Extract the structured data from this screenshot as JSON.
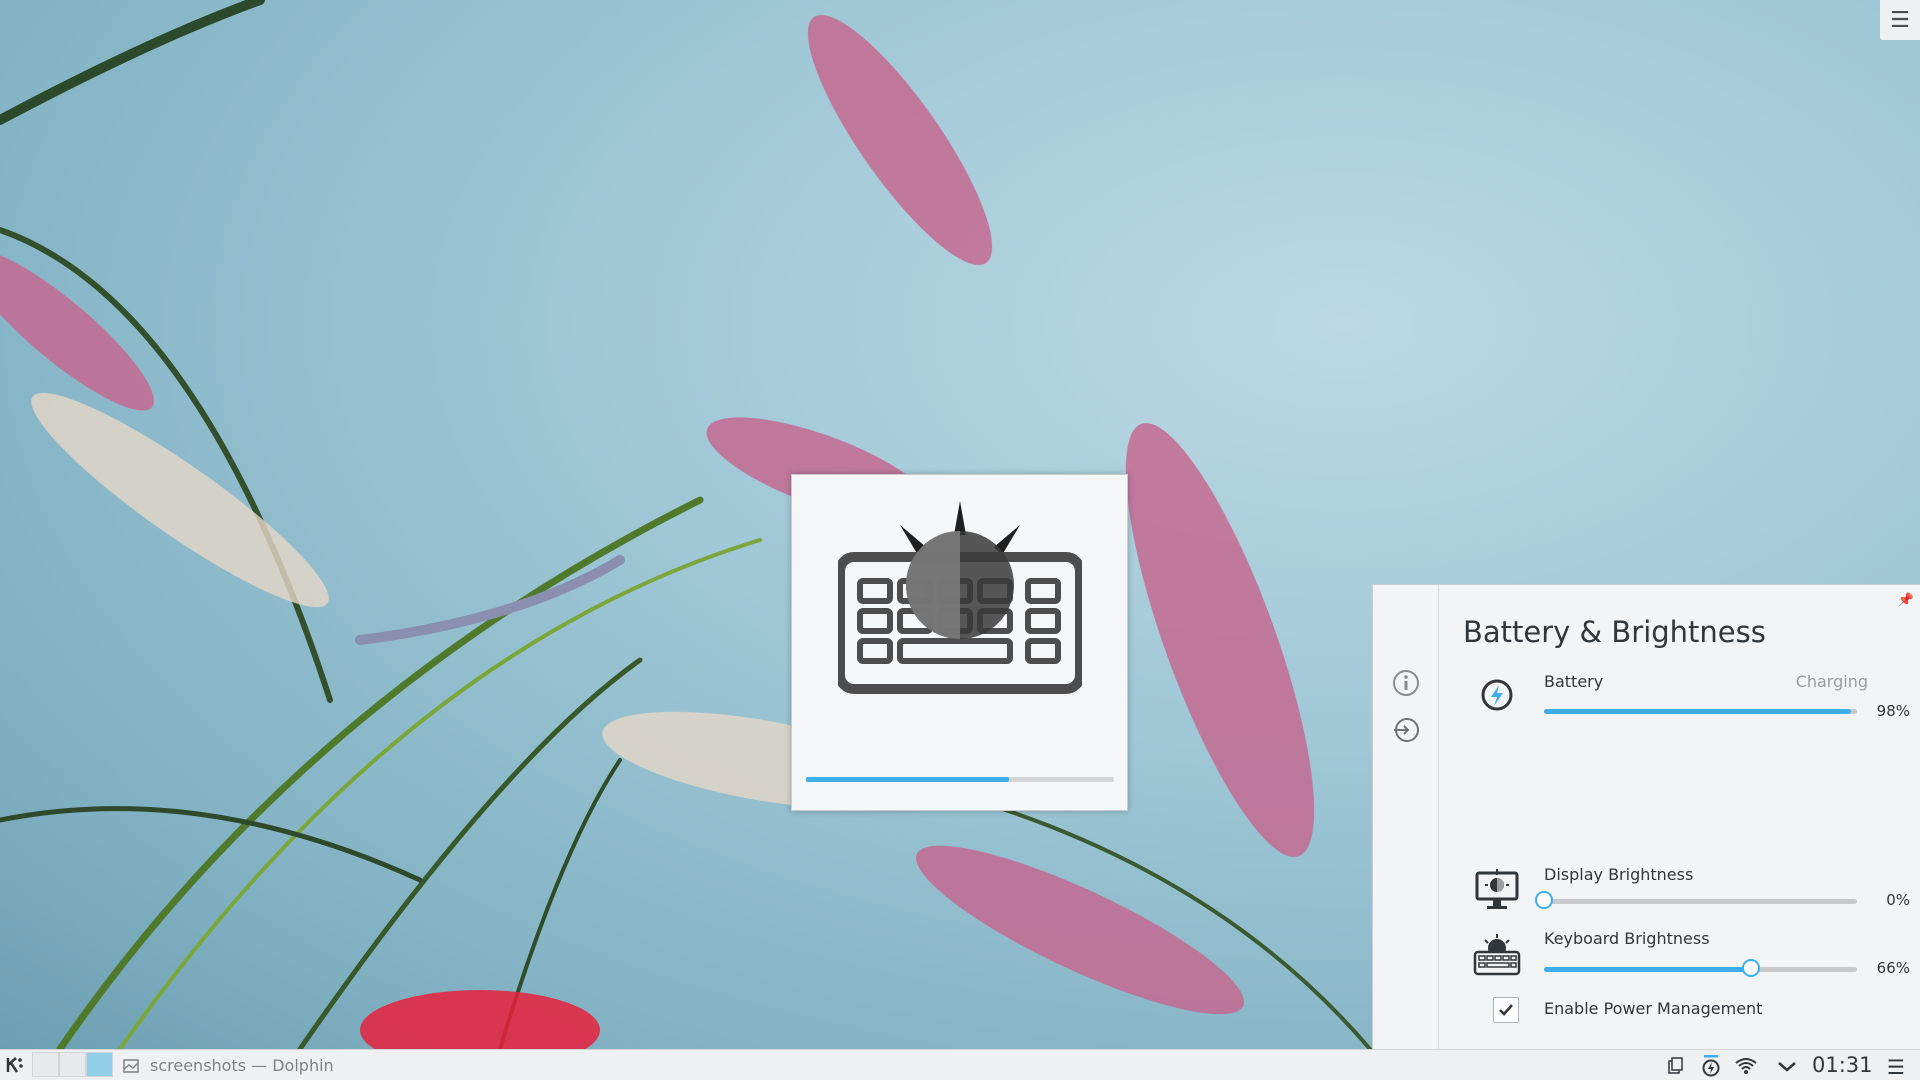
{
  "desktop": {
    "toolbox_icon": "hamburger-icon"
  },
  "osd": {
    "icon": "keyboard-brightness-icon",
    "progress": 0.66
  },
  "popup": {
    "title": "Battery & Brightness",
    "side_icons": [
      "info-icon",
      "power-profile-icon"
    ],
    "battery": {
      "label": "Battery",
      "status": "Charging",
      "percent_text": "98%",
      "level": 0.98
    },
    "display_brightness": {
      "label": "Display Brightness",
      "percent_text": "0%",
      "value": 0
    },
    "keyboard_brightness": {
      "label": "Keyboard Brightness",
      "percent_text": "66%",
      "value": 0.66
    },
    "power_management": {
      "label": "Enable Power Management",
      "checked": true
    }
  },
  "taskbar": {
    "task_label": "screenshots — Dolphin",
    "clock": "01:31",
    "tray_icons": [
      "clipboard-icon",
      "battery-icon",
      "wifi-icon",
      "expand-tray-icon"
    ]
  },
  "colors": {
    "accent": "#3daee9",
    "panel_bg": "#eff0f1",
    "text": "#31363b"
  }
}
